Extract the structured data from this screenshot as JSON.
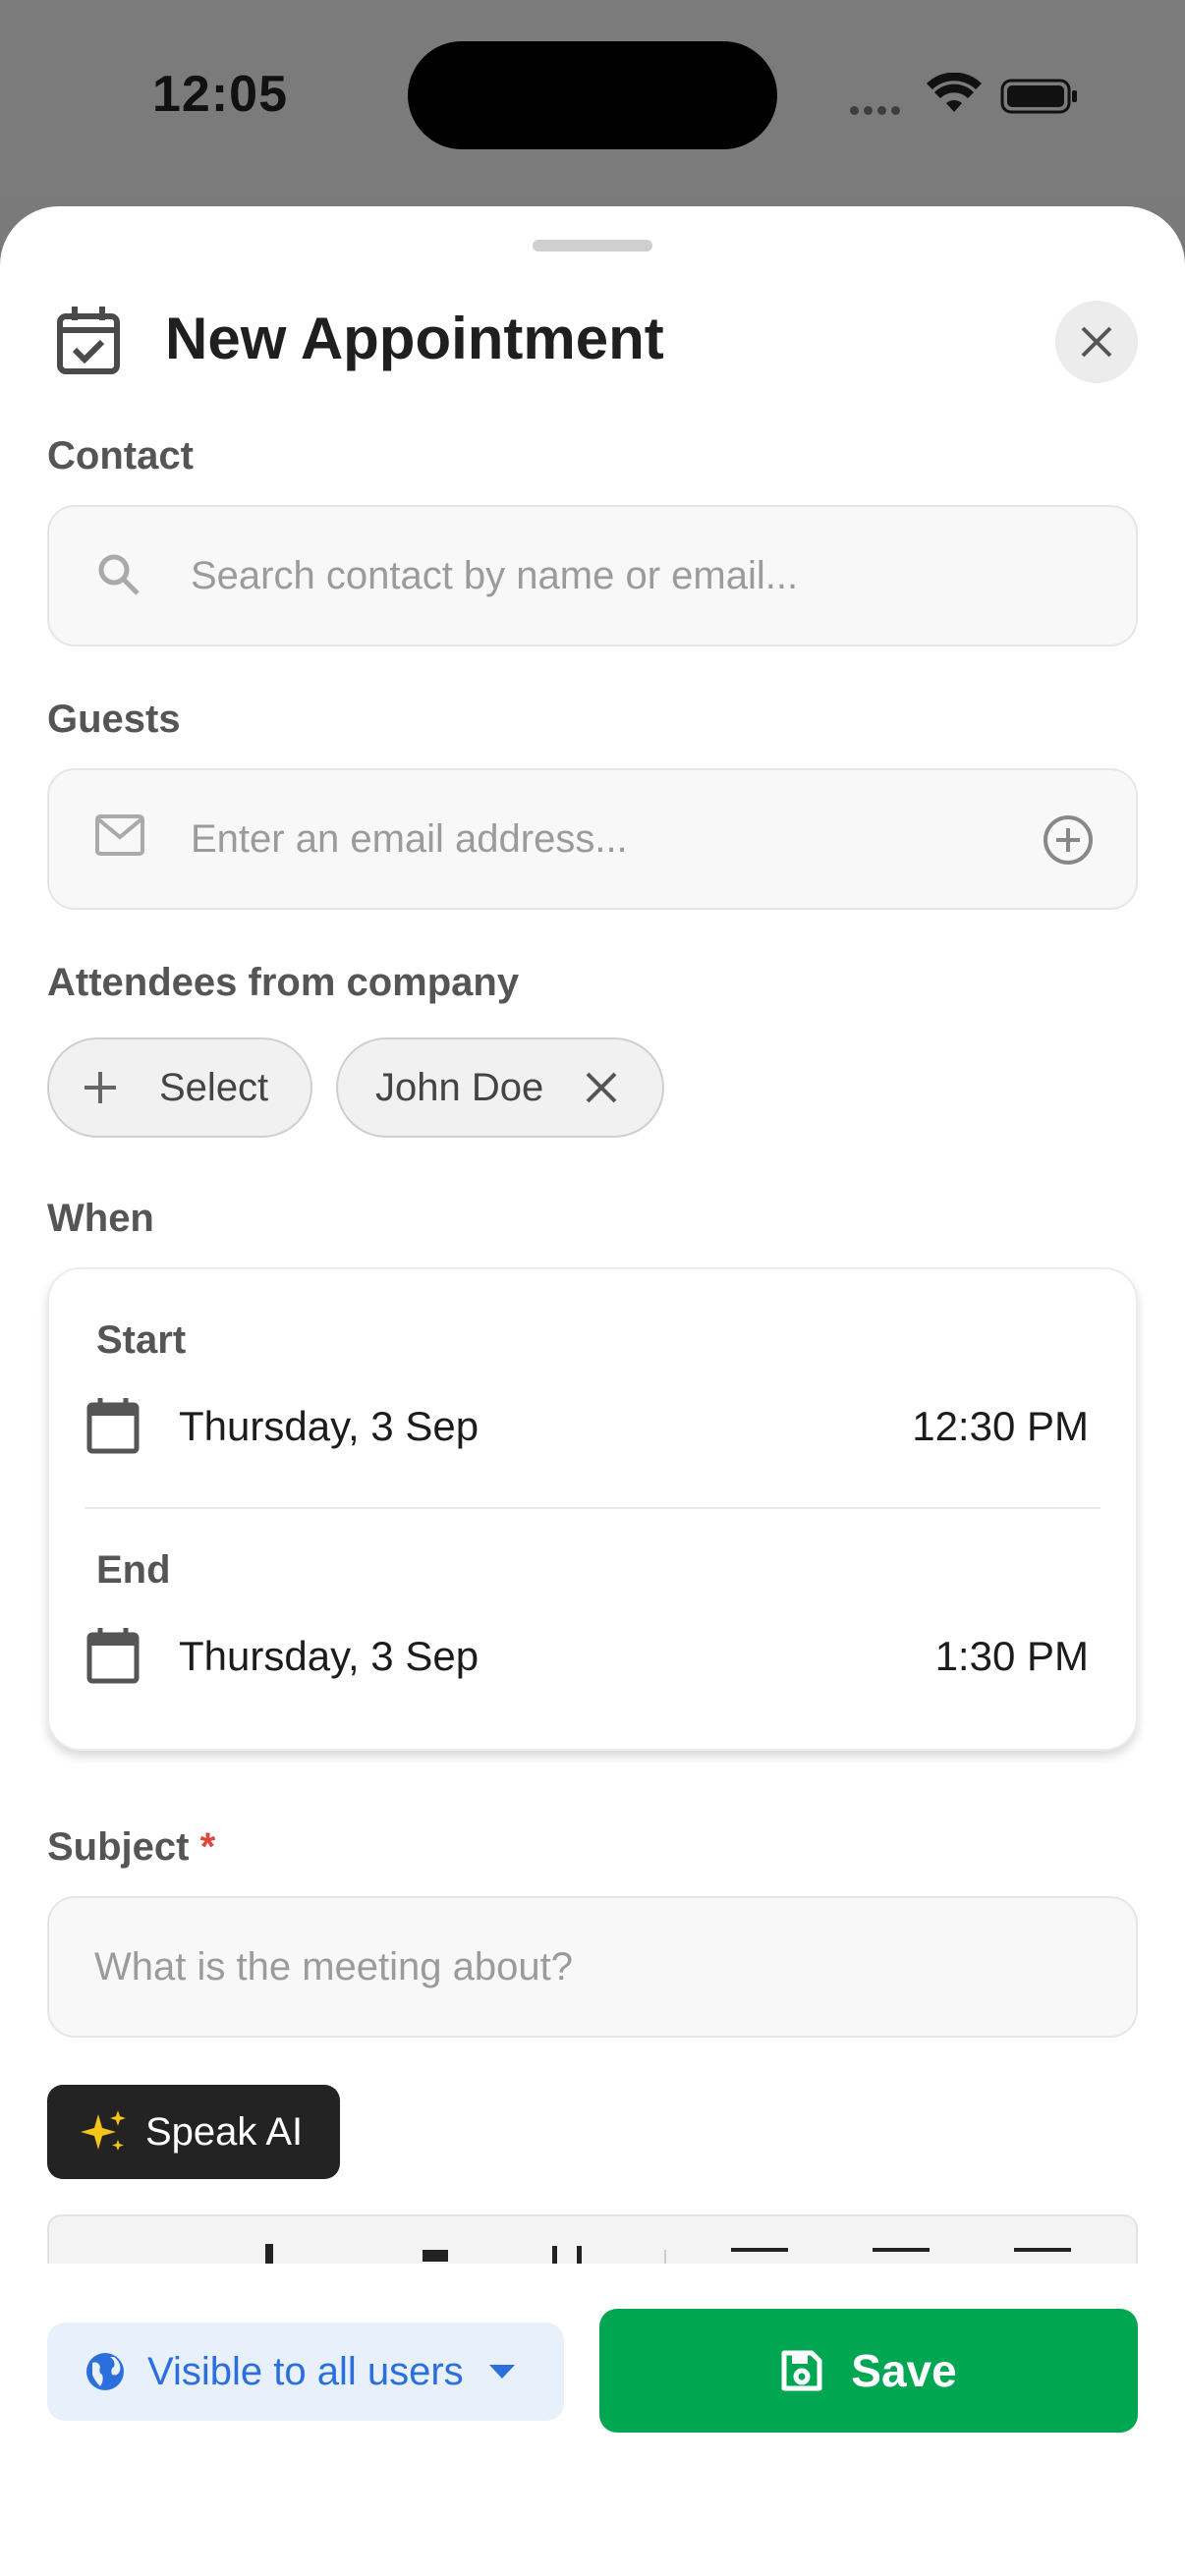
{
  "status_bar": {
    "time": "12:05"
  },
  "header": {
    "title": "New Appointment",
    "icon": "calendar-check-icon"
  },
  "contact": {
    "label": "Contact",
    "placeholder": "Search contact by name or email..."
  },
  "guests": {
    "label": "Guests",
    "placeholder": "Enter an email address..."
  },
  "attendees": {
    "label": "Attendees from company",
    "select_label": "Select",
    "chips": [
      {
        "label": "John Doe"
      }
    ]
  },
  "when": {
    "label": "When",
    "start": {
      "label": "Start",
      "date": "Thursday, 3 Sep",
      "time": "12:30 PM"
    },
    "end": {
      "label": "End",
      "date": "Thursday, 3 Sep",
      "time": "1:30 PM"
    }
  },
  "subject": {
    "label": "Subject",
    "required_mark": "*",
    "placeholder": "What is the meeting about?"
  },
  "speak_ai": {
    "label": "Speak AI"
  },
  "footer": {
    "visibility_label": "Visible to all users",
    "save_label": "Save"
  },
  "colors": {
    "save": "#00a651",
    "visibility_bg": "#e8f0fc",
    "visibility_text": "#2a6fdb",
    "required": "#e0463b",
    "speak_ai_bg": "#232323",
    "sparkle": "#f5c518"
  }
}
